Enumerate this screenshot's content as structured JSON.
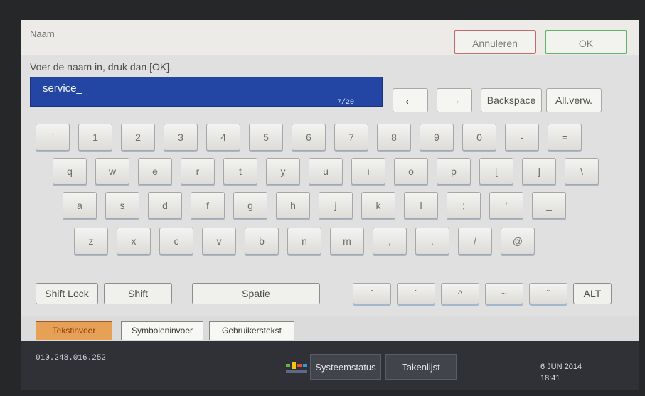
{
  "dialog": {
    "title": "Naam",
    "cancel_label": "Annuleren",
    "ok_label": "OK",
    "instruction": "Voer de naam in, druk dan [OK].",
    "input_value": "service_",
    "input_count": "7/20",
    "buttons": {
      "left_arrow": "←",
      "right_arrow": "→",
      "backspace": "Backspace",
      "clear_all": "All.verw."
    }
  },
  "keyboard": {
    "rows": [
      [
        "`",
        "1",
        "2",
        "3",
        "4",
        "5",
        "6",
        "7",
        "8",
        "9",
        "0",
        "-",
        "="
      ],
      [
        "q",
        "w",
        "e",
        "r",
        "t",
        "y",
        "u",
        "i",
        "o",
        "p",
        "[",
        "]",
        "\\"
      ],
      [
        "a",
        "s",
        "d",
        "f",
        "g",
        "h",
        "j",
        "k",
        "l",
        ";",
        "'",
        "_"
      ],
      [
        "z",
        "x",
        "c",
        "v",
        "b",
        "n",
        "m",
        ",",
        ".",
        "/",
        "@"
      ]
    ],
    "bottom": {
      "shift_lock": "Shift Lock",
      "shift": "Shift",
      "space": "Spatie",
      "accents": [
        "´",
        "`",
        "^",
        "~",
        "¨"
      ],
      "alt": "ALT"
    }
  },
  "tabs": [
    "Tekstinvoer",
    "Symboleninvoer",
    "Gebruikerstekst"
  ],
  "status": {
    "ip": "010.248.016.252",
    "system_status": "Systeemstatus",
    "job_list": "Takenlijst",
    "date": "6 JUN  2014",
    "time": "18:41"
  },
  "colors": {
    "input_bg": "#2345a4",
    "active_tab": "#e6a156",
    "cancel_border": "#c56a6a",
    "ok_border": "#5eb26a"
  }
}
